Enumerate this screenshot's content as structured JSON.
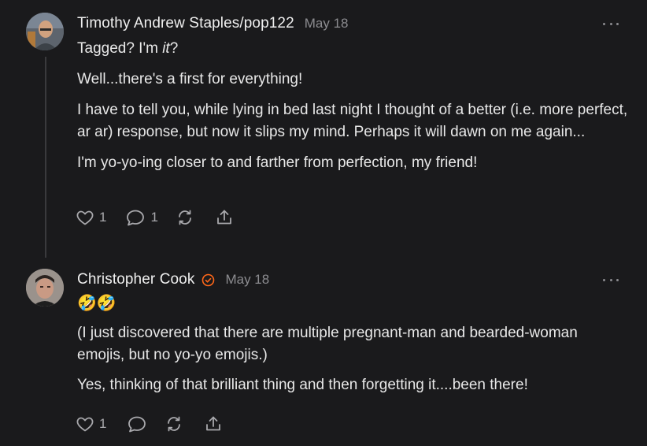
{
  "comments": [
    {
      "author": "Timothy Andrew Staples/pop122",
      "date": "May 18",
      "paragraphs": {
        "p1_prefix": "Tagged? I'm ",
        "p1_em": "it",
        "p1_suffix": "?",
        "p2": "Well...there's a first for everything!",
        "p3": "I have to tell you, while lying in bed last night I thought of a better (i.e. more perfect, ar ar) response, but now it slips my mind. Perhaps it will dawn on me again...",
        "p4": "I'm yo-yo-ing closer to and farther from perfection, my friend!"
      },
      "likes": "1",
      "replies": "1"
    },
    {
      "author": "Christopher Cook",
      "date": "May 18",
      "verified": true,
      "paragraphs": {
        "emojis": "🤣🤣",
        "p1": "(I just discovered that there are multiple pregnant-man and bearded-woman emojis, but no yo-yo emojis.)",
        "p2": "Yes, thinking of that brilliant thing and then forgetting it....been there!"
      },
      "likes": "1"
    }
  ],
  "icons": [
    "heart-icon",
    "comment-icon",
    "restack-icon",
    "share-icon",
    "more-icon",
    "verified-icon"
  ],
  "colors": {
    "background": "#1a1a1c",
    "text": "#ececec",
    "muted": "#8c8c90",
    "accent": "#ff6719"
  }
}
